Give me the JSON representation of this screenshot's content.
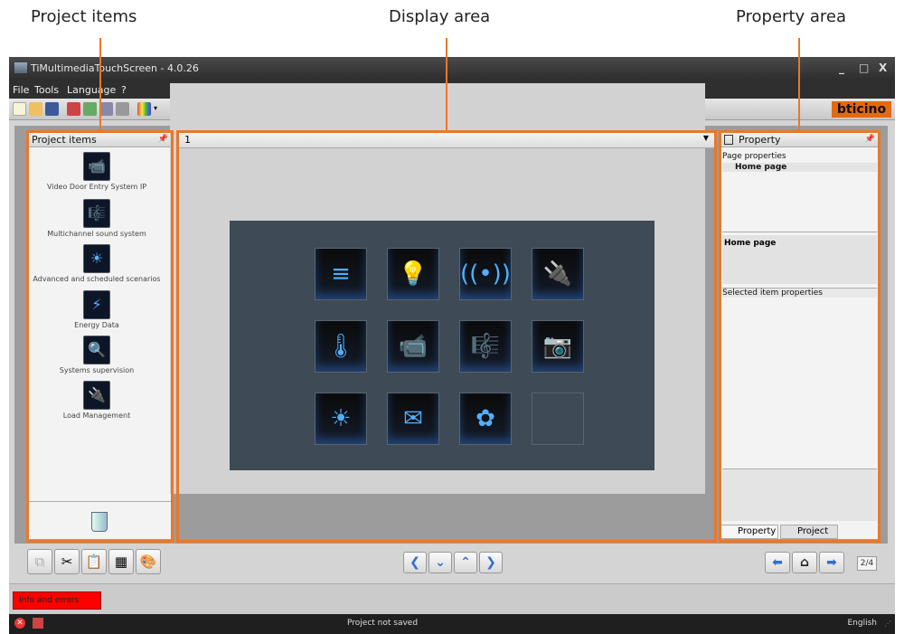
{
  "callouts": {
    "project_items": "Project items",
    "display_area": "Display area",
    "property_area": "Property area"
  },
  "window": {
    "title": "TiMultimediaTouchScreen - 4.0.26",
    "controls": [
      "_",
      "□",
      "X"
    ]
  },
  "menu": [
    "File",
    "Tools",
    "Language",
    "?"
  ],
  "toolbar": {
    "icons": [
      "new-icon",
      "open-icon",
      "save-icon",
      "send-icon",
      "receive-icon",
      "update-icon",
      "settings-icon",
      "grid-icon",
      "dropdown-icon"
    ],
    "brand": "bticino"
  },
  "project_items": {
    "title": "Project items",
    "items": [
      {
        "label": "Video Door Entry System IP",
        "icon": "📹"
      },
      {
        "label": "Multichannel sound system",
        "icon": "🎼"
      },
      {
        "label": "Advanced and scheduled scenarios",
        "icon": "☀"
      },
      {
        "label": "Energy Data",
        "icon": "⚡"
      },
      {
        "label": "Systems supervision",
        "icon": "🔍"
      },
      {
        "label": "Load Management",
        "icon": "🔌"
      }
    ]
  },
  "display": {
    "page_select": "1",
    "tiles": [
      "≡",
      "💡",
      "((•))",
      "🔌",
      "🌡",
      "📹",
      "🎼",
      "📷",
      "☀",
      "✉",
      "✿",
      ""
    ]
  },
  "property": {
    "title": "Property",
    "page_properties_label": "Page properties",
    "page_value": "Home page",
    "page_name": "Home page",
    "selected_label": "Selected item properties",
    "tabs": [
      "Property",
      "Project"
    ]
  },
  "bottom": {
    "page_count": "2/4",
    "info_button": "Info and errors"
  },
  "status": {
    "message": "Project not saved",
    "language": "English"
  },
  "colors": {
    "accent": "#e8782a",
    "error": "#ff0000",
    "brand": "#e26a12"
  }
}
